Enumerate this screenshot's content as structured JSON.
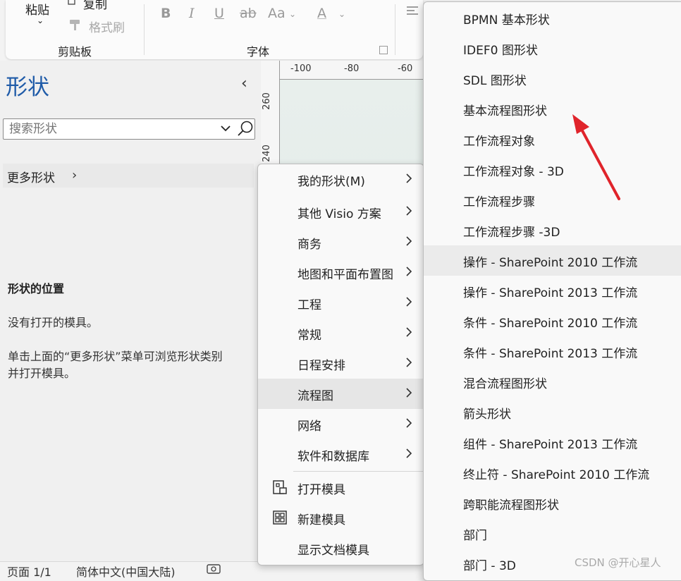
{
  "ribbon": {
    "paste_label": "粘贴",
    "copy_label": "复制",
    "format_painter_label": "格式刷",
    "clipboard_group": "剪贴板",
    "font_group": "字体",
    "bold": "B",
    "italic": "I",
    "underline": "U",
    "strike": "ab",
    "font_size": "Aa",
    "font_color": "A"
  },
  "shapes_pane": {
    "title": "形状",
    "search_placeholder": "搜索形状",
    "more_shapes": "更多形状",
    "location_heading": "形状的位置",
    "no_stencils": "没有打开的模具。",
    "hint_line1": "单击上面的“更多形状”菜单可浏览形状类别",
    "hint_line2": "并打开模具。"
  },
  "ruler": {
    "top": [
      "-100",
      "-80",
      "-60"
    ],
    "left": [
      "260",
      "240"
    ]
  },
  "menu_categories": [
    {
      "label": "我的形状(M)"
    },
    {
      "label": "其他 Visio 方案"
    },
    {
      "label": "商务"
    },
    {
      "label": "地图和平面布置图"
    },
    {
      "label": "工程"
    },
    {
      "label": "常规"
    },
    {
      "label": "日程安排"
    },
    {
      "label": "流程图"
    },
    {
      "label": "网络"
    },
    {
      "label": "软件和数据库"
    }
  ],
  "menu_actions": {
    "open_stencil": "打开模具",
    "new_stencil": "新建模具",
    "show_document_stencil": "显示文档模具"
  },
  "submenu_flowchart": [
    "BPMN 基本形状",
    "IDEF0 图形状",
    "SDL 图形状",
    "基本流程图形状",
    "工作流程对象",
    "工作流程对象 - 3D",
    "工作流程步骤",
    "工作流程步骤 -3D",
    "操作 - SharePoint 2010 工作流",
    "操作 - SharePoint 2013 工作流",
    "条件 - SharePoint 2010 工作流",
    "条件 - SharePoint 2013 工作流",
    "混合流程图形状",
    "箭头形状",
    "组件 - SharePoint 2013 工作流",
    "终止符 - SharePoint 2010 工作流",
    "跨职能流程图形状",
    "部门",
    "部门 - 3D"
  ],
  "statusbar": {
    "page": "页面 1/1",
    "language": "简体中文(中国大陆)"
  },
  "watermark": "CSDN @开心星人",
  "colors": {
    "title_blue": "#1f5ba8",
    "annotation_arrow": "#e0242b",
    "highlight": "#e6e6e6"
  }
}
